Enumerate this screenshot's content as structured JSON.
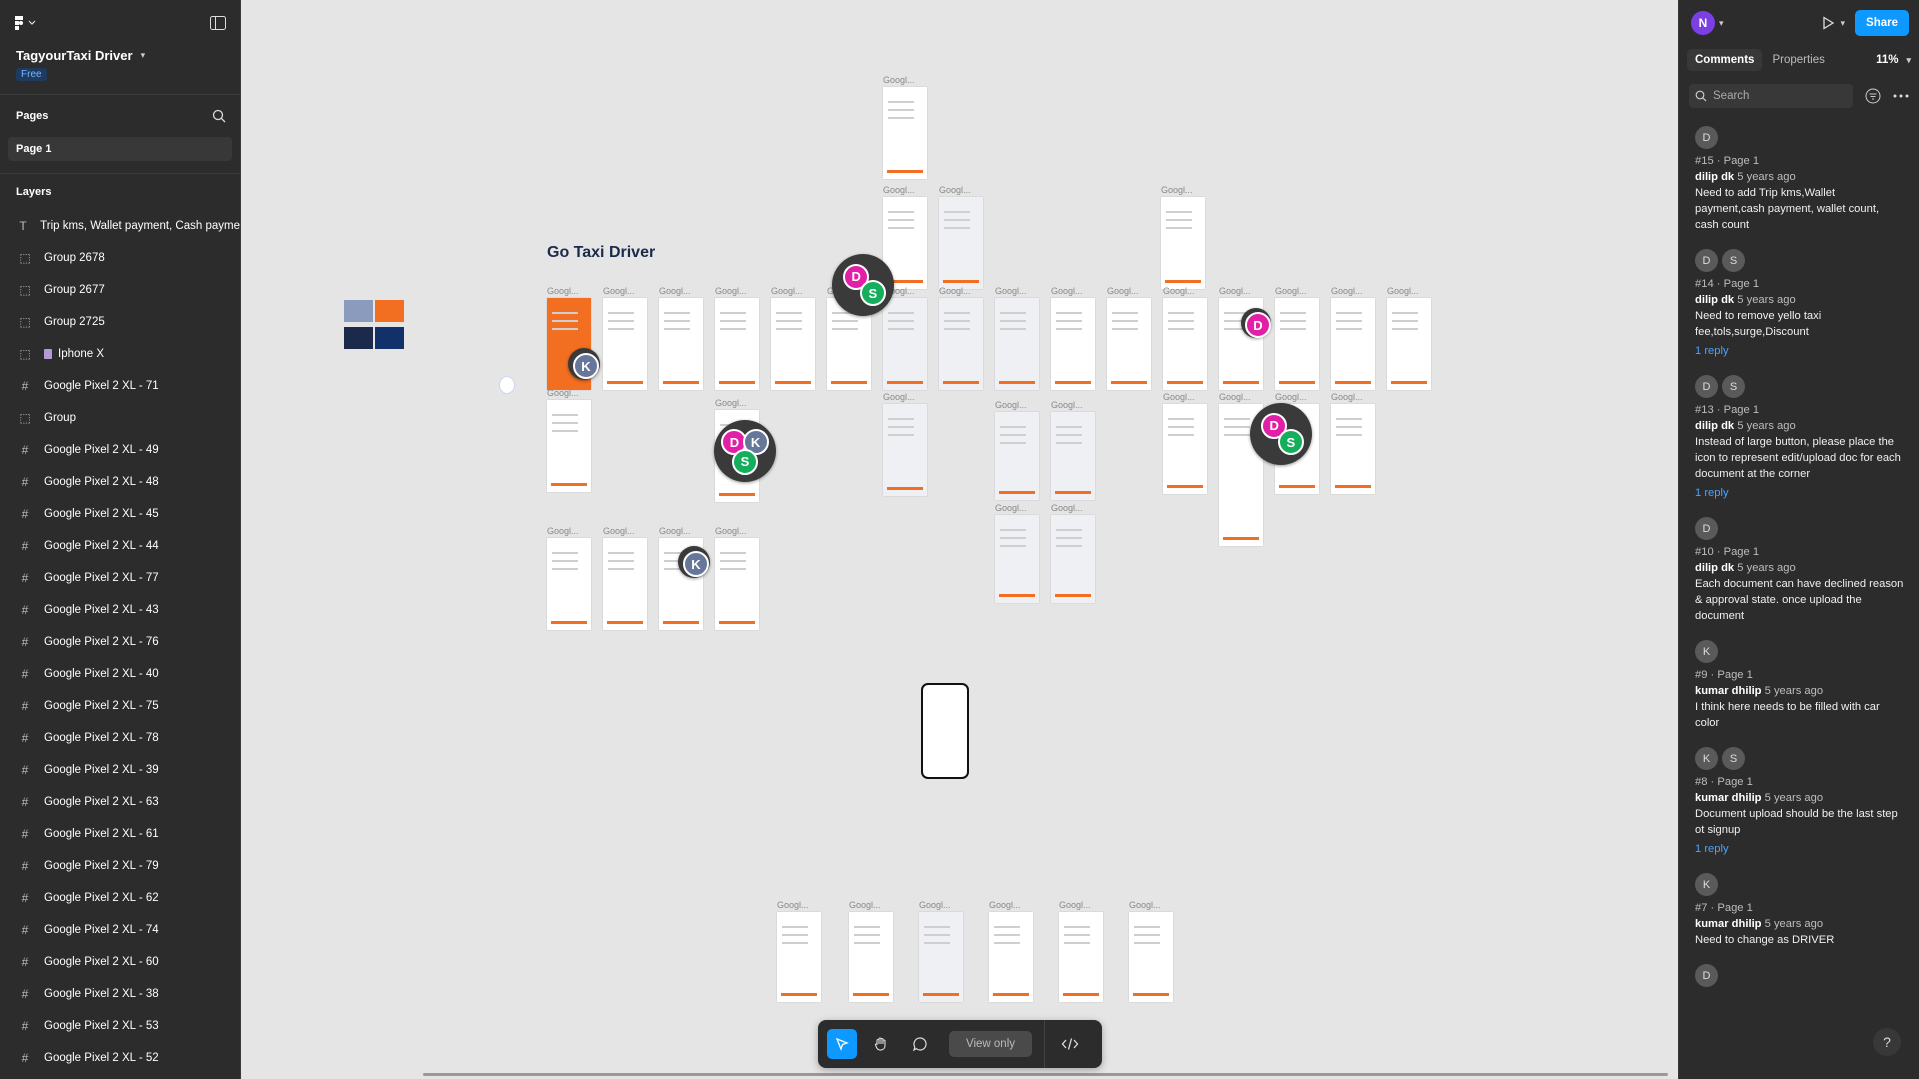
{
  "project": {
    "title": "TagyourTaxi Driver",
    "plan": "Free"
  },
  "pages": {
    "heading": "Pages",
    "items": [
      "Page 1"
    ]
  },
  "layers": {
    "heading": "Layers",
    "items": [
      {
        "label": "Trip kms, Wallet payment, Cash payme",
        "icon": "text-icon"
      },
      {
        "label": "Group 2678",
        "icon": "group-icon"
      },
      {
        "label": "Group 2677",
        "icon": "group-icon"
      },
      {
        "label": "Group 2725",
        "icon": "group-icon"
      },
      {
        "label": "Iphone X",
        "icon": "image-group-icon"
      },
      {
        "label": "Google Pixel 2 XL - 71",
        "icon": "frame-icon"
      },
      {
        "label": "Group",
        "icon": "group-icon"
      },
      {
        "label": "Google Pixel 2 XL - 49",
        "icon": "frame-icon"
      },
      {
        "label": "Google Pixel 2 XL - 48",
        "icon": "frame-icon"
      },
      {
        "label": "Google Pixel 2 XL - 45",
        "icon": "frame-icon"
      },
      {
        "label": "Google Pixel 2 XL - 44",
        "icon": "frame-icon"
      },
      {
        "label": "Google Pixel 2 XL - 77",
        "icon": "frame-icon"
      },
      {
        "label": "Google Pixel 2 XL - 43",
        "icon": "frame-icon"
      },
      {
        "label": "Google Pixel 2 XL - 76",
        "icon": "frame-icon"
      },
      {
        "label": "Google Pixel 2 XL - 40",
        "icon": "frame-icon"
      },
      {
        "label": "Google Pixel 2 XL - 75",
        "icon": "frame-icon"
      },
      {
        "label": "Google Pixel 2 XL - 78",
        "icon": "frame-icon"
      },
      {
        "label": "Google Pixel 2 XL - 39",
        "icon": "frame-icon"
      },
      {
        "label": "Google Pixel 2 XL - 63",
        "icon": "frame-icon"
      },
      {
        "label": "Google Pixel 2 XL - 61",
        "icon": "frame-icon"
      },
      {
        "label": "Google Pixel 2 XL - 79",
        "icon": "frame-icon"
      },
      {
        "label": "Google Pixel 2 XL - 62",
        "icon": "frame-icon"
      },
      {
        "label": "Google Pixel 2 XL - 74",
        "icon": "frame-icon"
      },
      {
        "label": "Google Pixel 2 XL - 60",
        "icon": "frame-icon"
      },
      {
        "label": "Google Pixel 2 XL - 38",
        "icon": "frame-icon"
      },
      {
        "label": "Google Pixel 2 XL - 53",
        "icon": "frame-icon"
      },
      {
        "label": "Google Pixel 2 XL - 52",
        "icon": "frame-icon"
      }
    ]
  },
  "header": {
    "user_initial": "N",
    "share_label": "Share",
    "zoom": "11%"
  },
  "tabs": [
    "Comments",
    "Properties"
  ],
  "search": {
    "placeholder": "Search"
  },
  "comments": [
    {
      "avatars": [
        "D"
      ],
      "meta": "#15 · Page 1",
      "author": "dilip dk",
      "time": "5 years ago",
      "text": "Need to add Trip kms,Wallet payment,cash payment, wallet count, cash count",
      "reply": ""
    },
    {
      "avatars": [
        "D",
        "S"
      ],
      "meta": "#14 · Page 1",
      "author": "dilip dk",
      "time": "5 years ago",
      "text": "Need to remove yello taxi fee,tols,surge,Discount",
      "reply": "1 reply"
    },
    {
      "avatars": [
        "D",
        "S"
      ],
      "meta": "#13 · Page 1",
      "author": "dilip dk",
      "time": "5 years ago",
      "text": "Instead of large button, please place the icon to represent edit/upload doc for each document at the corner",
      "reply": "1 reply"
    },
    {
      "avatars": [
        "D"
      ],
      "meta": "#10 · Page 1",
      "author": "dilip dk",
      "time": "5 years ago",
      "text": "Each document can have declined reason & approval state. once upload the document",
      "reply": ""
    },
    {
      "avatars": [
        "K"
      ],
      "meta": "#9 · Page 1",
      "author": "kumar dhilip",
      "time": "5 years ago",
      "text": "I think here needs to be filled with car color",
      "reply": ""
    },
    {
      "avatars": [
        "K",
        "S"
      ],
      "meta": "#8 · Page 1",
      "author": "kumar dhilip",
      "time": "5 years ago",
      "text": "Document upload should be the last step ot signup",
      "reply": "1 reply"
    },
    {
      "avatars": [
        "K"
      ],
      "meta": "#7 · Page 1",
      "author": "kumar dhilip",
      "time": "5 years ago",
      "text": "Need to change as DRIVER",
      "reply": ""
    },
    {
      "avatars": [
        "D"
      ],
      "meta": "",
      "author": "",
      "time": "",
      "text": "",
      "reply": ""
    }
  ],
  "canvas": {
    "title": "Go Taxi Driver",
    "frame_label": "Googl...",
    "swatch_colors": [
      "#8a9bbd",
      "#f26f21",
      "#1b2a4a",
      "#12316b"
    ],
    "markers": [
      {
        "initials": [
          "D",
          "S"
        ]
      },
      {
        "initials": [
          "K"
        ]
      },
      {
        "initials": [
          "D",
          "K",
          "S"
        ]
      },
      {
        "initials": [
          "K"
        ]
      },
      {
        "initials": [
          "D"
        ]
      },
      {
        "initials": [
          "D",
          "S"
        ]
      }
    ],
    "marker_colors": {
      "D": "#e21fa7",
      "S": "#14ae5c",
      "K": "#667799"
    }
  },
  "toolbar": {
    "view_only": "View only"
  },
  "help": "?"
}
